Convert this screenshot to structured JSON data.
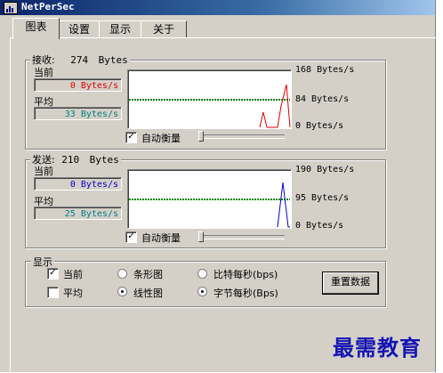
{
  "window": {
    "title": "NetPerSec"
  },
  "tabs": [
    {
      "label": "图表",
      "active": true
    },
    {
      "label": "设置",
      "active": false
    },
    {
      "label": "显示",
      "active": false
    },
    {
      "label": "关于",
      "active": false
    }
  ],
  "receive": {
    "group_label": "接收:",
    "total_value": "274",
    "total_unit": "Bytes",
    "current_label": "当前",
    "current_value": "0  Bytes/s",
    "average_label": "平均",
    "average_value": "33  Bytes/s",
    "scale_max": "168  Bytes/s",
    "scale_mid": "84  Bytes/s",
    "scale_min": "0  Bytes/s",
    "autoscale_label": "自动衡量",
    "autoscale_checked": true,
    "value_color": "#e00000",
    "average_color": "#008080",
    "line_color": "#e00000"
  },
  "send": {
    "group_label": "发送:",
    "total_value": "210",
    "total_unit": "Bytes",
    "current_label": "当前",
    "current_value": "0  Bytes/s",
    "average_label": "平均",
    "average_value": "25  Bytes/s",
    "scale_max": "190  Bytes/s",
    "scale_mid": "95  Bytes/s",
    "scale_min": "0  Bytes/s",
    "autoscale_label": "自动衡量",
    "autoscale_checked": true,
    "value_color": "#0000c8",
    "average_color": "#008080",
    "line_color": "#0000c8"
  },
  "display": {
    "group_label": "显示",
    "show_current_label": "当前",
    "show_current_checked": true,
    "show_average_label": "平均",
    "show_average_checked": false,
    "bar_chart_label": "条形图",
    "line_chart_label": "线性图",
    "chart_style_selected": "线性图",
    "bits_label": "比特每秒(bps)",
    "bytes_label": "字节每秒(Bps)",
    "unit_selected": "字节每秒(Bps)",
    "reset_label": "重置数据"
  },
  "watermark": "最需教育",
  "grid_color": "#008000"
}
